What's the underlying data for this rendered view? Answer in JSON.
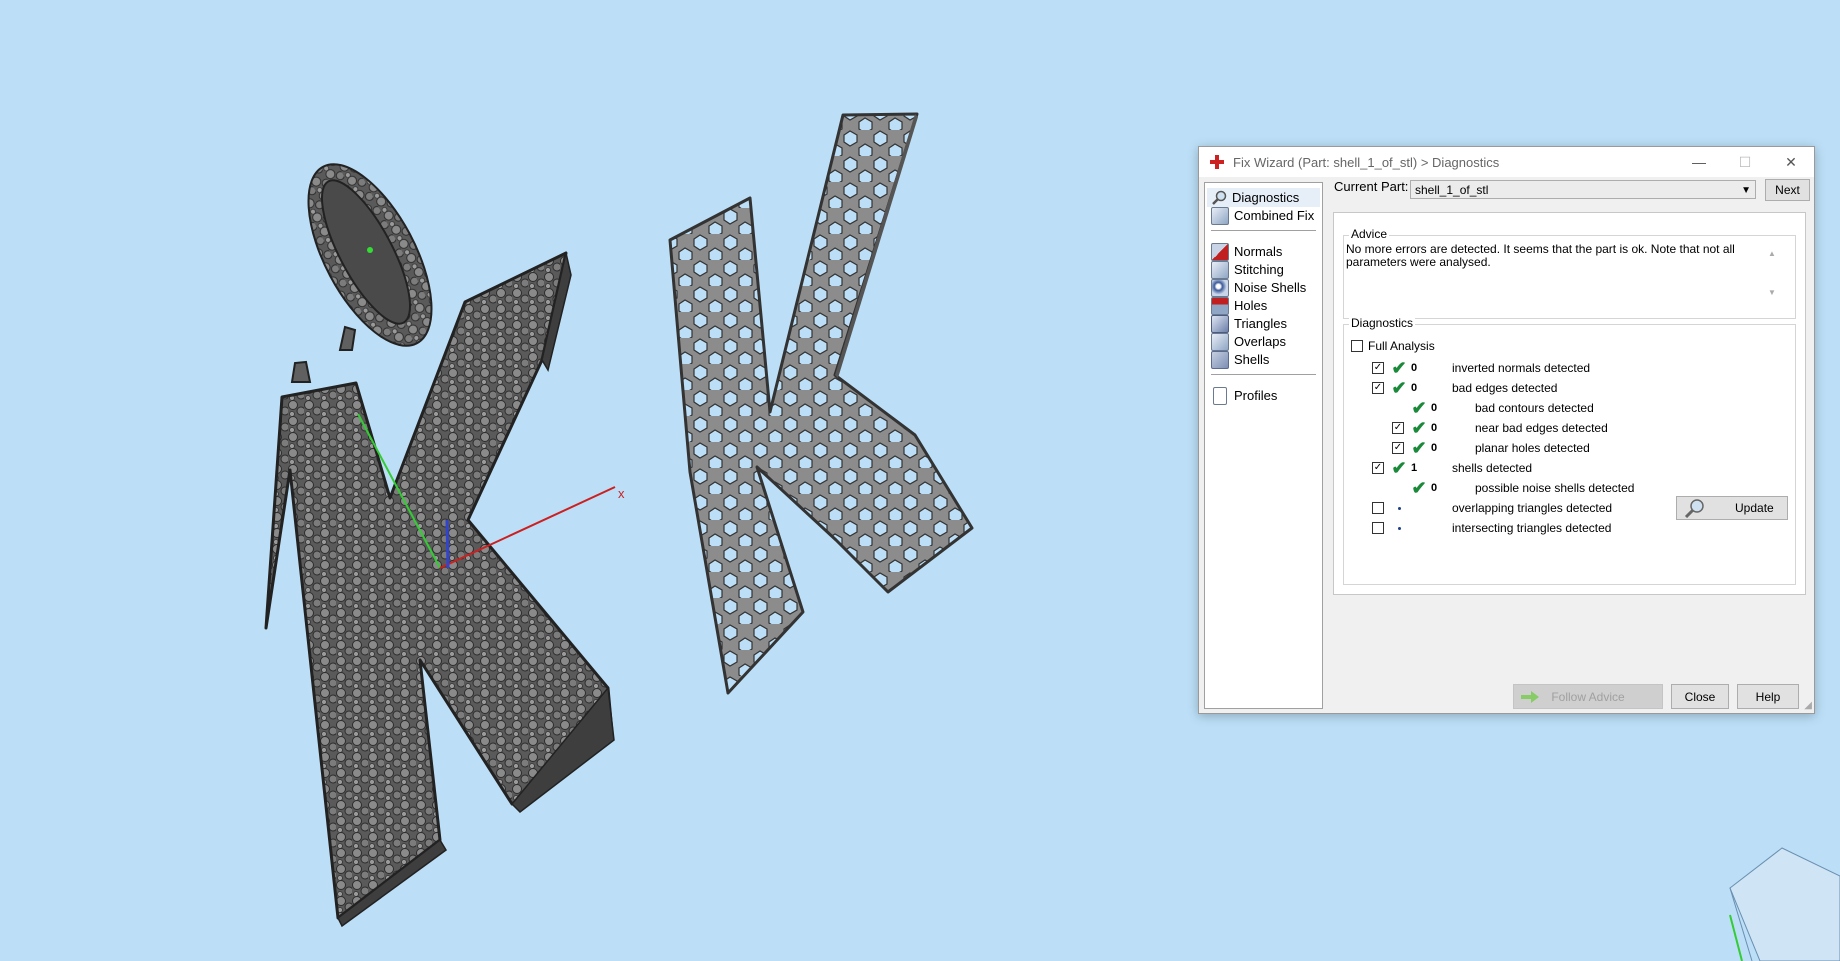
{
  "window": {
    "title": "Fix Wizard (Part: shell_1_of_stl) > Diagnostics",
    "min": "—",
    "max": "☐",
    "close": "✕"
  },
  "nav": {
    "items": [
      {
        "label": "Diagnostics",
        "icon": "magnifier-icon"
      },
      {
        "label": "Combined Fix",
        "icon": "cube-icon"
      },
      {
        "label": "Normals",
        "icon": "normals-cube-icon"
      },
      {
        "label": "Stitching",
        "icon": "stitching-cube-icon"
      },
      {
        "label": "Noise Shells",
        "icon": "noise-shells-icon"
      },
      {
        "label": "Holes",
        "icon": "holes-cube-icon"
      },
      {
        "label": "Triangles",
        "icon": "triangles-cube-icon"
      },
      {
        "label": "Overlaps",
        "icon": "overlaps-cube-icon"
      },
      {
        "label": "Shells",
        "icon": "shells-cube-icon"
      },
      {
        "label": "Profiles",
        "icon": "document-icon"
      }
    ]
  },
  "header": {
    "current_part_label": "Current Part:",
    "current_part_value": "shell_1_of_stl",
    "next_label": "Next"
  },
  "advice": {
    "label": "Advice",
    "text": "No more errors are detected. It seems that the part is ok. Note that not all parameters were analysed."
  },
  "diagnostics": {
    "label": "Diagnostics",
    "full_analysis_label": "Full Analysis",
    "full_analysis_checked": false,
    "rows": [
      {
        "checkbox": true,
        "checked": true,
        "status": "ok",
        "count": "0",
        "label": "inverted normals detected",
        "indent": 0
      },
      {
        "checkbox": true,
        "checked": true,
        "status": "ok",
        "count": "0",
        "label": "bad edges detected",
        "indent": 0
      },
      {
        "checkbox": false,
        "checked": false,
        "status": "ok",
        "count": "0",
        "label": "bad contours detected",
        "indent": 1
      },
      {
        "checkbox": true,
        "checked": true,
        "status": "ok",
        "count": "0",
        "label": "near bad edges detected",
        "indent": 1
      },
      {
        "checkbox": true,
        "checked": true,
        "status": "ok",
        "count": "0",
        "label": "planar holes detected",
        "indent": 1
      },
      {
        "checkbox": true,
        "checked": true,
        "status": "ok",
        "count": "1",
        "label": "shells detected",
        "indent": 0
      },
      {
        "checkbox": false,
        "checked": false,
        "status": "ok",
        "count": "0",
        "label": "possible noise shells detected",
        "indent": 1
      },
      {
        "checkbox": true,
        "checked": false,
        "status": "unknown",
        "count": "",
        "label": "overlapping triangles detected",
        "indent": 0
      },
      {
        "checkbox": true,
        "checked": false,
        "status": "unknown",
        "count": "",
        "label": "intersecting triangles detected",
        "indent": 0
      }
    ],
    "update_label": "Update"
  },
  "footer": {
    "follow_advice_label": "Follow Advice",
    "close_label": "Close",
    "help_label": "Help"
  },
  "viewport": {
    "axis_x_label": "x",
    "background": "#bcdff7",
    "model_color": "#5f5f5f"
  },
  "colors": {
    "check": "#1a8a3a",
    "title_icon": "#cc2222"
  }
}
